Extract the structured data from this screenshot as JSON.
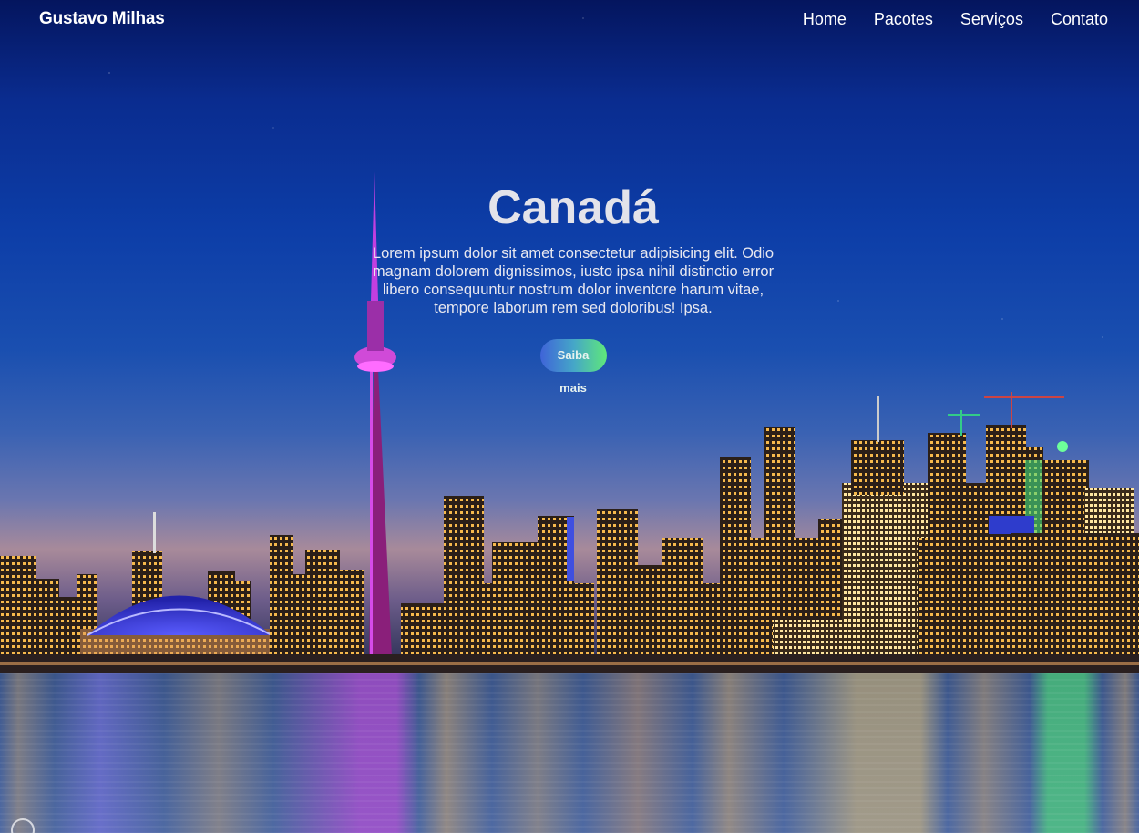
{
  "header": {
    "brand": "Gustavo Milhas",
    "nav": [
      {
        "label": "Home"
      },
      {
        "label": "Pacotes"
      },
      {
        "label": "Serviços"
      },
      {
        "label": "Contato"
      }
    ]
  },
  "hero": {
    "title": "Canadá",
    "description": "Lorem ipsum dolor sit amet consectetur adipisicing elit. Odio magnam dolorem dignissimos, iusto ipsa nihil distinctio error libero consequuntur nostrum dolor inventore harum vitae, tempore laborum rem sed doloribus! Ipsa.",
    "button_label": "Saiba mais"
  },
  "colors": {
    "sky_top": "#04155e",
    "button_start": "#3f64d8",
    "button_end": "#5fe87a",
    "tower_accent": "#c23fe0"
  }
}
